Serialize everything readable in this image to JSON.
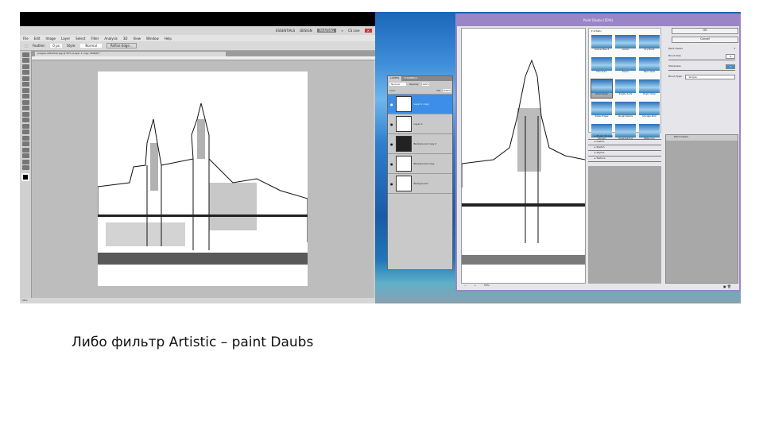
{
  "photoshop": {
    "app_buttons": [
      "ESSENTIALS",
      "DESIGN",
      "PAINTING",
      "»",
      "CS Live"
    ],
    "menu": [
      "File",
      "Edit",
      "Image",
      "Layer",
      "Select",
      "Filter",
      "Analysis",
      "3D",
      "View",
      "Window",
      "Help"
    ],
    "options": {
      "feather_label": "Feather:",
      "feather_value": "0 px",
      "style_label": "Style:",
      "style_value": "Normal",
      "refine_label": "Refine Edge..."
    },
    "doc_tab": "prague-cathedral.jpg @ 50% (Layer 1 copy, RGB/8) *",
    "status": "50%"
  },
  "layers_panel": {
    "tabs": [
      "LAYERS",
      "CHANNELS"
    ],
    "blend_mode": "Normal",
    "opacity_label": "Opacity:",
    "opacity": "100%",
    "fill_label": "Fill:",
    "fill": "100%",
    "lock_label": "Lock:",
    "layers": [
      {
        "name": "Layer 1 copy",
        "selected": true,
        "dark": false
      },
      {
        "name": "Layer 1",
        "selected": false,
        "dark": false
      },
      {
        "name": "Background copy 2",
        "selected": false,
        "dark": true
      },
      {
        "name": "Background copy",
        "selected": false,
        "dark": false
      },
      {
        "name": "Background",
        "selected": false,
        "dark": false
      }
    ]
  },
  "filter_gallery": {
    "title": "Paint Daubs (50%)",
    "category_open": "Artistic",
    "filters": [
      "Colored Pencil",
      "Cutout",
      "Dry Brush",
      "Film Grain",
      "Fresco",
      "Neon Glow",
      "Paint Daubs",
      "Palette Knife",
      "Plastic Wrap",
      "Poster Edges",
      "Rough Pastels",
      "Smudge Stick",
      "Sponge",
      "Underpainting",
      "Watercolor"
    ],
    "selected_filter": "Paint Daubs",
    "categories": [
      "Brush Strokes",
      "Distort",
      "Sketch",
      "Stylize",
      "Texture"
    ],
    "ok": "OK",
    "cancel": "Cancel",
    "effect_select": "Paint Daubs",
    "brush_size_label": "Brush Size",
    "brush_size": "8",
    "sharpness_label": "Sharpness",
    "sharpness": "7",
    "brush_type_label": "Brush Type:",
    "brush_type": "Simple",
    "effect_layer": "Paint Daubs",
    "zoom": "50%"
  },
  "caption": "Либо фильтр Artistic – paint Daubs"
}
